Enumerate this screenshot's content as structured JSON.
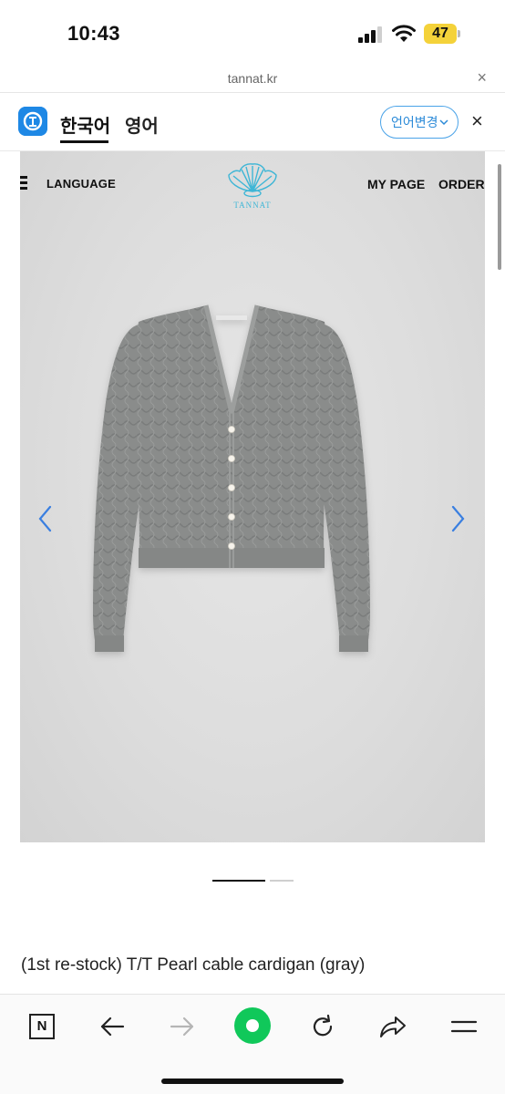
{
  "status_bar": {
    "time": "10:43",
    "battery": "47"
  },
  "url_bar": {
    "url": "tannat.kr",
    "close_label": "×"
  },
  "translate_bar": {
    "tab_korean": "한국어",
    "tab_english": "영어",
    "change_language": "언어변경",
    "close_label": "×"
  },
  "site_header": {
    "language": "LANGUAGE",
    "my_page": "MY PAGE",
    "order": "ORDER",
    "logo_text": "TANNAT"
  },
  "gallery": {
    "current_slide": 1,
    "total_slides": 2
  },
  "product": {
    "title": "(1st re-stock) T/T Pearl cable cardigan (gray)"
  },
  "bottom_bar": {
    "n_label": "N"
  },
  "colors": {
    "accent_blue": "#2b8ad8",
    "home_green": "#10c85a",
    "battery_yellow": "#f4d23a",
    "logo_teal": "#3fb6d6"
  }
}
